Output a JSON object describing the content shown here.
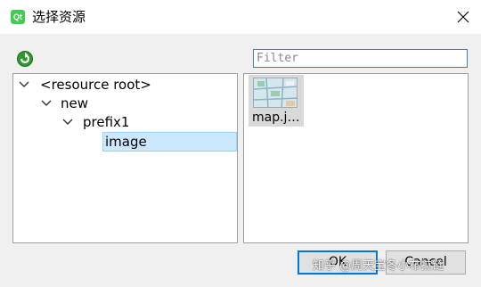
{
  "window": {
    "title": "选择资源",
    "app_icon": "Qt",
    "close_icon": "close-icon"
  },
  "toolbar": {
    "refresh_icon": "refresh-icon"
  },
  "filter": {
    "placeholder": "Filter",
    "value": ""
  },
  "tree": {
    "items": [
      {
        "label": "<resource root>",
        "expanded": true
      },
      {
        "label": "new",
        "expanded": true
      },
      {
        "label": "prefix1",
        "expanded": true
      },
      {
        "label": "image",
        "selected": true
      }
    ]
  },
  "files": [
    {
      "label": "map.j…",
      "icon": "image-thumbnail-icon"
    }
  ],
  "buttons": {
    "ok": "OK",
    "cancel": "Cancel"
  },
  "watermark": "知乎 @周天宝冬小布拉链",
  "colors": {
    "accent": "#0078d7",
    "selection": "#cce8ff",
    "focus_border": "#3c7fb1"
  }
}
